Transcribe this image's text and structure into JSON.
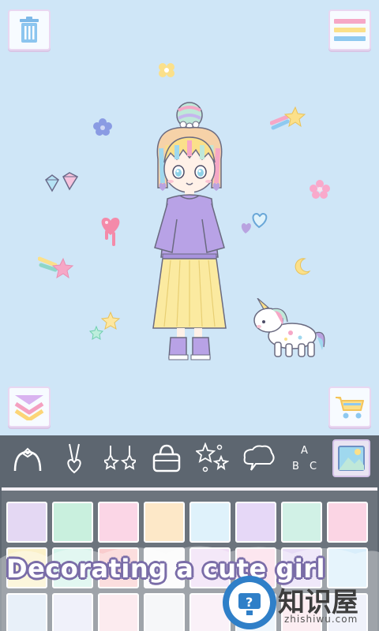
{
  "caption": "Decorating a cute girl",
  "watermark": {
    "name": "知识屋",
    "url": "zhishiwu.com"
  },
  "colors": {
    "sky": "#cfe6f7",
    "toolbar": "#5d6670",
    "accent": "#b9a3e0"
  },
  "top_buttons": [
    {
      "name": "trash-icon"
    },
    {
      "name": "menu-icon"
    }
  ],
  "bottom_buttons": [
    {
      "name": "layers-chevron-icon"
    },
    {
      "name": "cart-icon"
    }
  ],
  "tools": [
    {
      "name": "headband-icon"
    },
    {
      "name": "necklace-icon"
    },
    {
      "name": "earrings-icon"
    },
    {
      "name": "bag-icon"
    },
    {
      "name": "sparkles-icon"
    },
    {
      "name": "speech-bubble-icon"
    },
    {
      "name": "letters-icon",
      "letters": [
        "A",
        "B",
        "C"
      ]
    },
    {
      "name": "background-icon",
      "active": true
    }
  ],
  "swatches": [
    "#e4d8f3",
    "#c9f0de",
    "#fbd6e6",
    "#fde8c8",
    "#dff2fb",
    "#e6d8f7",
    "#d1f1e6",
    "#fbd5e4",
    "#fbf1c9",
    "#d3f3ea",
    "#f9cccd",
    "#fbfbfb",
    "#efdcf4",
    "#fbd9e6",
    "#e7dcf6",
    "#d9eefb",
    "#dce8f6",
    "#e9eaf7",
    "#fbe1e7",
    "#f2f3f6",
    "#f7eaf4",
    "#e7f1fb",
    "#fbe3ec",
    "#e8ecf7"
  ]
}
